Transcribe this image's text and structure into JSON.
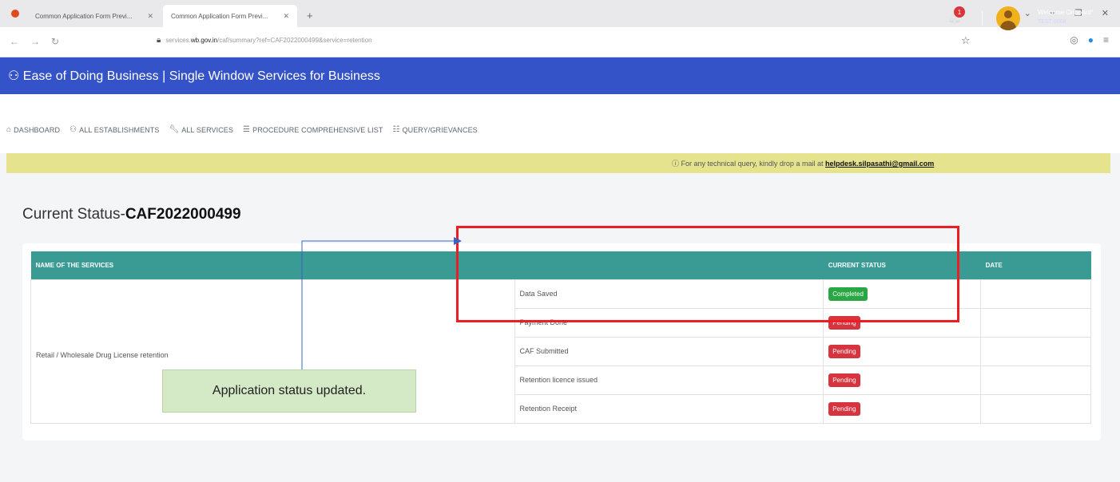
{
  "browser": {
    "tabs": [
      {
        "label": "Common Application Form Previ..."
      },
      {
        "label": "Common Application Form Previ..."
      }
    ],
    "url_prefix": "services.",
    "url_host": "wb.gov.in",
    "url_rest": "/caf/summary?ref=CAF2022000499&service=retention"
  },
  "app": {
    "title": "Ease of Doing Business | Single Window Services for Business",
    "notification_count": "1",
    "welcome": "Welcome Onboard*",
    "user_id": "TEST 0008"
  },
  "menu": [
    {
      "label": "DASHBOARD",
      "icon": "home-icon"
    },
    {
      "label": "ALL ESTABLISHMENTS",
      "icon": "building-icon"
    },
    {
      "label": "ALL SERVICES",
      "icon": "wrench-icon"
    },
    {
      "label": "PROCEDURE COMPREHENSIVE LIST",
      "icon": "list-icon"
    },
    {
      "label": "QUERY/GRIEVANCES",
      "icon": "list-icon"
    }
  ],
  "notice": {
    "text": "For any technical query, kindly drop a mail at",
    "email": "helpdesk.silpasathi@gmail.com"
  },
  "page": {
    "title_prefix": "Current Status-",
    "caf_number": "CAF2022000499"
  },
  "table": {
    "headers": [
      "NAME OF THE SERVICES",
      "",
      "CURRENT STATUS",
      "DATE"
    ],
    "service_name": "Retail / Wholesale Drug License retention",
    "rows": [
      {
        "step": "Data Saved",
        "status": "Completed",
        "date": ""
      },
      {
        "step": "Payment Done",
        "status": "Pending",
        "date": ""
      },
      {
        "step": "CAF Submitted",
        "status": "Pending",
        "date": ""
      },
      {
        "step": "Retention licence issued",
        "status": "Pending",
        "date": ""
      },
      {
        "step": "Retention Receipt",
        "status": "Pending",
        "date": ""
      }
    ]
  },
  "annotation": {
    "callout": "Application status updated."
  },
  "colors": {
    "appbar": "#3553c8",
    "table_header": "#3a9b95",
    "completed": "#29a745",
    "pending": "#d7343f",
    "notice_bg": "#e6e38e",
    "highlight": "#ee1d23"
  }
}
